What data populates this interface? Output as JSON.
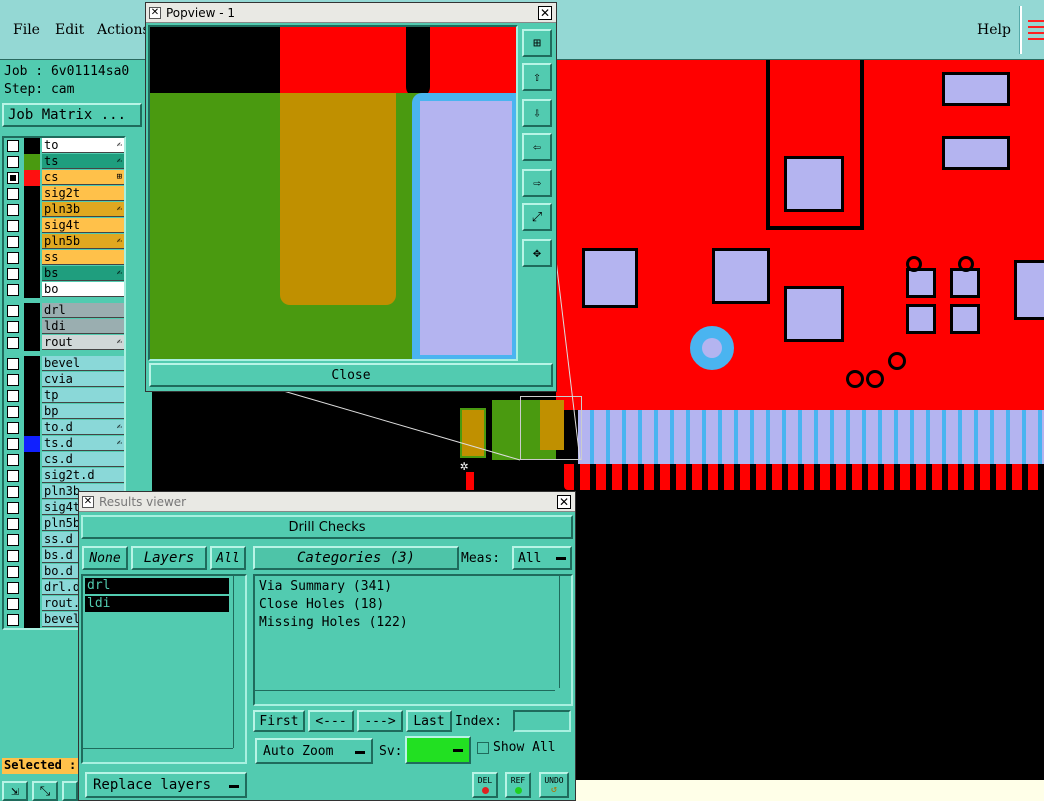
{
  "menubar": {
    "file": "File",
    "edit": "Edit",
    "actions": "Actions",
    "help": "Help"
  },
  "job": {
    "job_label": "Job : 6v01114sa0",
    "step_label": "Step: cam",
    "matrix_button": "Job Matrix ..."
  },
  "layers": [
    {
      "name": "to",
      "color": "#ffffff",
      "swatch": "#000000",
      "checked": false,
      "mark": "✍"
    },
    {
      "name": "ts",
      "color": "#1f9e7e",
      "swatch": "#4a9a10",
      "checked": false,
      "mark": "✍"
    },
    {
      "name": "cs",
      "color": "#ffc14a",
      "swatch": "#ff1010",
      "checked": true,
      "mark": "⊞"
    },
    {
      "name": "sig2t",
      "color": "#ffc14a",
      "swatch": "#000000",
      "checked": false,
      "mark": ""
    },
    {
      "name": "pln3b",
      "color": "#e0a820",
      "swatch": "#000000",
      "checked": false,
      "mark": "✍"
    },
    {
      "name": "sig4t",
      "color": "#ffc14a",
      "swatch": "#000000",
      "checked": false,
      "mark": ""
    },
    {
      "name": "pln5b",
      "color": "#e0a820",
      "swatch": "#000000",
      "checked": false,
      "mark": "✍"
    },
    {
      "name": "ss",
      "color": "#ffc14a",
      "swatch": "#000000",
      "checked": false,
      "mark": ""
    },
    {
      "name": "bs",
      "color": "#1f9e7e",
      "swatch": "#000000",
      "checked": false,
      "mark": "✍"
    },
    {
      "name": "bo",
      "color": "#ffffff",
      "swatch": "#000000",
      "checked": false,
      "mark": ""
    },
    {
      "name": "drl",
      "color": "#9aaeb0",
      "swatch": "#000000",
      "checked": false,
      "mark": ""
    },
    {
      "name": "ldi",
      "color": "#9aaeb0",
      "swatch": "#000000",
      "checked": false,
      "mark": ""
    },
    {
      "name": "rout",
      "color": "#d0d8d8",
      "swatch": "#000000",
      "checked": false,
      "mark": "✍"
    },
    {
      "name": "bevel",
      "color": "#8ad8d8",
      "swatch": "#000000",
      "checked": false,
      "mark": ""
    },
    {
      "name": "cvia",
      "color": "#8ad8d8",
      "swatch": "#000000",
      "checked": false,
      "mark": ""
    },
    {
      "name": "tp",
      "color": "#8ad8d8",
      "swatch": "#000000",
      "checked": false,
      "mark": ""
    },
    {
      "name": "bp",
      "color": "#8ad8d8",
      "swatch": "#000000",
      "checked": false,
      "mark": ""
    },
    {
      "name": "to.d",
      "color": "#8ad8d8",
      "swatch": "#000000",
      "checked": false,
      "mark": "✍"
    },
    {
      "name": "ts.d",
      "color": "#8ad8d8",
      "swatch": "#1020ff",
      "checked": false,
      "mark": "✍"
    },
    {
      "name": "cs.d",
      "color": "#8ad8d8",
      "swatch": "#000000",
      "checked": false,
      "mark": ""
    },
    {
      "name": "sig2t.d",
      "color": "#8ad8d8",
      "swatch": "#000000",
      "checked": false,
      "mark": ""
    },
    {
      "name": "pln3b",
      "color": "#8ad8d8",
      "swatch": "#000000",
      "checked": false,
      "mark": ""
    },
    {
      "name": "sig4t",
      "color": "#8ad8d8",
      "swatch": "#000000",
      "checked": false,
      "mark": ""
    },
    {
      "name": "pln5b",
      "color": "#8ad8d8",
      "swatch": "#000000",
      "checked": false,
      "mark": ""
    },
    {
      "name": "ss.d",
      "color": "#8ad8d8",
      "swatch": "#000000",
      "checked": false,
      "mark": ""
    },
    {
      "name": "bs.d",
      "color": "#8ad8d8",
      "swatch": "#000000",
      "checked": false,
      "mark": ""
    },
    {
      "name": "bo.d",
      "color": "#8ad8d8",
      "swatch": "#000000",
      "checked": false,
      "mark": ""
    },
    {
      "name": "drl.d",
      "color": "#8ad8d8",
      "swatch": "#000000",
      "checked": false,
      "mark": ""
    },
    {
      "name": "rout.",
      "color": "#8ad8d8",
      "swatch": "#000000",
      "checked": false,
      "mark": ""
    },
    {
      "name": "bevel",
      "color": "#8ad8d8",
      "swatch": "#000000",
      "checked": false,
      "mark": ""
    }
  ],
  "selected_label": "Selected :",
  "popview": {
    "title": "Popview - 1",
    "close_label": "Close"
  },
  "results": {
    "title": "Results viewer",
    "header": "Drill Checks",
    "none_label": "None",
    "layers_label": "Layers",
    "all_label": "All",
    "categories_label": "Categories (3)",
    "meas_label": "Meas:",
    "meas_value": "All",
    "layer_items": [
      "drl",
      "ldi"
    ],
    "categories": [
      "Via Summary (341)",
      "Close Holes (18)",
      "Missing Holes (122)"
    ],
    "first": "First",
    "prev": "<---",
    "next": "--->",
    "last": "Last",
    "index_label": "Index:",
    "index_value": "",
    "auto_zoom": "Auto Zoom",
    "sv_label": "Sv:",
    "show_all": "Show All",
    "replace_layers": "Replace layers",
    "del": "DEL",
    "ref": "REF",
    "undo": "UNDO"
  },
  "colors": {
    "copper": "#ff0000",
    "pad": "#b4b4f0",
    "ui": "#52cbb0",
    "title": "#e9e9e4"
  }
}
